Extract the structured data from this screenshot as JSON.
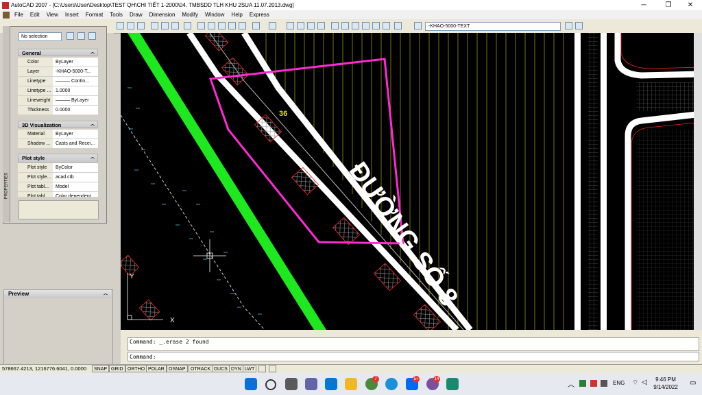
{
  "window": {
    "title": "AutoCAD 2007 - [C:\\Users\\User\\Desktop\\TEST QH\\CHI TIẾT 1-2000\\04. TMBSDD  TLH KHU 2SUA 11.07.2013.dwg]",
    "minimize": "─",
    "restore": "❐",
    "close": "✕"
  },
  "menu": [
    "File",
    "Edit",
    "View",
    "Insert",
    "Format",
    "Tools",
    "Draw",
    "Dimension",
    "Modify",
    "Window",
    "Help",
    "Express"
  ],
  "toolbar": {
    "layer_name": "-KHAO-5000-TEXT"
  },
  "properties": {
    "selection": "No selection",
    "palette_title": "PROPERTIES",
    "sections": [
      {
        "title": "General",
        "rows": [
          {
            "label": "Color",
            "value": "ByLayer"
          },
          {
            "label": "Layer",
            "value": "-KHAO-5000-T..."
          },
          {
            "label": "Linetype",
            "value": "——— Contin..."
          },
          {
            "label": "Linetype ...",
            "value": "1.0000"
          },
          {
            "label": "Lineweight",
            "value": "——— ByLayer"
          },
          {
            "label": "Thickness",
            "value": "0.0000"
          }
        ]
      },
      {
        "title": "3D Visualization",
        "rows": [
          {
            "label": "Material",
            "value": "ByLayer"
          },
          {
            "label": "Shadow ...",
            "value": "Casts and Recei..."
          }
        ]
      },
      {
        "title": "Plot style",
        "rows": [
          {
            "label": "Plot style",
            "value": "ByColor"
          },
          {
            "label": "Plot style...",
            "value": "acad.ctb"
          },
          {
            "label": "Plot tabl...",
            "value": "Model"
          },
          {
            "label": "Plot tabl",
            "value": "Color dependent"
          }
        ]
      }
    ]
  },
  "preview": {
    "title": "Preview"
  },
  "drawing": {
    "street_label": "ĐƯỜNG SỐ 8",
    "number_label": "36",
    "colors": {
      "background": "#000000",
      "road_white": "#ffffff",
      "green_band": "#1ee81e",
      "selection": "#ff2ad4",
      "hatch_lines": "#c8c800",
      "red_lines": "#ff2020"
    }
  },
  "command": {
    "history": "Command:  _.erase 2 found",
    "prompt": "Command:"
  },
  "status": {
    "coordinates": "578667.4213, 1216776.6041, 0.0000",
    "toggles": [
      "SNAP",
      "GRID",
      "ORTHO",
      "POLAR",
      "OSNAP",
      "OTRACK",
      "DUCS",
      "DYN",
      "LWT"
    ]
  },
  "taskbar": {
    "lang": "ENG",
    "time": "9:46 PM",
    "date": "9/14/2022",
    "badges": {
      "chrome": "7",
      "zalo": "5+",
      "viber": "14"
    }
  }
}
